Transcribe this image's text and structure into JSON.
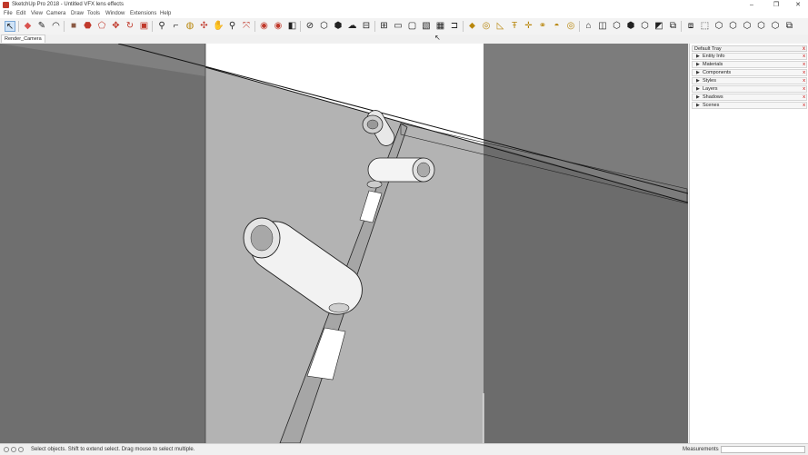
{
  "app": {
    "title": "SketchUp Pro 2018 - Untitled VFX lens effects",
    "window_controls": [
      "–",
      "❐",
      "✕"
    ]
  },
  "menu": [
    "File",
    "Edit",
    "View",
    "Camera",
    "Draw",
    "Tools",
    "Window",
    "Extensions",
    "Help"
  ],
  "toolbar": {
    "tools": [
      {
        "name": "select-tool",
        "glyph": "↖",
        "active": true
      },
      {
        "name": "eraser-tool",
        "glyph": "◆",
        "color": "#d9534f"
      },
      {
        "name": "line-tool",
        "glyph": "✎"
      },
      {
        "name": "arc-tool",
        "glyph": "◠"
      },
      {
        "name": "rectangle-tool",
        "glyph": "■",
        "color": "#8a5a44"
      },
      {
        "name": "push-pull-tool",
        "glyph": "⬣",
        "color": "#c0392b"
      },
      {
        "name": "follow-me-tool",
        "glyph": "⬠",
        "color": "#c0392b"
      },
      {
        "name": "move-tool",
        "glyph": "✥",
        "color": "#c0392b"
      },
      {
        "name": "rotate-tool",
        "glyph": "↻",
        "color": "#c0392b"
      },
      {
        "name": "scale-tool",
        "glyph": "▣",
        "color": "#c0392b"
      },
      {
        "name": "tape-measure-tool",
        "glyph": "⚲"
      },
      {
        "name": "dimension-tool",
        "glyph": "⌐"
      },
      {
        "name": "paint-bucket-tool",
        "glyph": "◍",
        "color": "#b8860b"
      },
      {
        "name": "orbit-tool",
        "glyph": "✣",
        "color": "#c0392b"
      },
      {
        "name": "pan-tool",
        "glyph": "✋"
      },
      {
        "name": "zoom-tool",
        "glyph": "⚲"
      },
      {
        "name": "zoom-extents-tool",
        "glyph": "⤧",
        "color": "#c0392b"
      },
      {
        "name": "warehouse-icon",
        "glyph": "◉",
        "color": "#c0392b"
      },
      {
        "name": "extension-warehouse-icon",
        "glyph": "◉",
        "color": "#c0392b"
      },
      {
        "name": "layout-icon",
        "glyph": "◧"
      },
      {
        "name": "sandbox-smoove-icon",
        "glyph": "⊘"
      },
      {
        "name": "sandbox-from-contours-icon",
        "glyph": "⬡"
      },
      {
        "name": "sandbox-from-scratch-icon",
        "glyph": "⬢"
      },
      {
        "name": "sandbox-stamp-icon",
        "glyph": "☁"
      },
      {
        "name": "section-plane-icon",
        "glyph": "⊟"
      },
      {
        "name": "section-cut-icon",
        "glyph": "⊞"
      },
      {
        "name": "style-xray-icon",
        "glyph": "▭"
      },
      {
        "name": "style-backedges-icon",
        "glyph": "▢"
      },
      {
        "name": "style-wireframe-icon",
        "glyph": "▧"
      },
      {
        "name": "style-hidden-line-icon",
        "glyph": "▦"
      },
      {
        "name": "solid-tools-icon",
        "glyph": "⊐"
      },
      {
        "name": "cylinder-icon",
        "glyph": "⬥",
        "color": "#b8860b"
      },
      {
        "name": "circle-icon",
        "glyph": "◎",
        "color": "#b8860b"
      },
      {
        "name": "protractor-icon",
        "glyph": "◺",
        "color": "#b8860b"
      },
      {
        "name": "text-tool-icon",
        "glyph": "Ŧ",
        "color": "#b8860b"
      },
      {
        "name": "axes-tool-icon",
        "glyph": "✛",
        "color": "#b8860b"
      },
      {
        "name": "3d-text-icon",
        "glyph": "⚭",
        "color": "#b8860b"
      },
      {
        "name": "arc-pie-icon",
        "glyph": "◓",
        "color": "#b8860b"
      },
      {
        "name": "polygon-icon",
        "glyph": "◎",
        "color": "#b8860b"
      },
      {
        "name": "view-iso-icon",
        "glyph": "⌂"
      },
      {
        "name": "view-top-icon",
        "glyph": "◫"
      },
      {
        "name": "view-front-icon",
        "glyph": "⬡"
      },
      {
        "name": "view-right-icon",
        "glyph": "⬢"
      },
      {
        "name": "view-back-icon",
        "glyph": "⬡"
      },
      {
        "name": "view-left-icon",
        "glyph": "◩"
      },
      {
        "name": "camera-standard-icon",
        "glyph": "⧉"
      },
      {
        "name": "camera-parallel-icon",
        "glyph": "⧈"
      },
      {
        "name": "camera-position-icon",
        "glyph": "⬚"
      },
      {
        "name": "camera-walk-icon",
        "glyph": "⬡"
      },
      {
        "name": "camera-look-around-icon",
        "glyph": "⬡"
      },
      {
        "name": "camera-zoom-window-icon",
        "glyph": "⬡"
      },
      {
        "name": "camera-previous-icon",
        "glyph": "⬡"
      },
      {
        "name": "camera-next-icon",
        "glyph": "⬡"
      },
      {
        "name": "component-icon",
        "glyph": "⧉"
      }
    ]
  },
  "scene_tab": "Render_Camera",
  "tray": {
    "title": "Default Tray",
    "panels": [
      "Entity Info",
      "Materials",
      "Components",
      "Styles",
      "Layers",
      "Shadows",
      "Scenes"
    ]
  },
  "status": {
    "text": "Select objects. Shift to extend select. Drag mouse to select multiple.",
    "measurements_label": "Measurements",
    "measurements_value": ""
  }
}
